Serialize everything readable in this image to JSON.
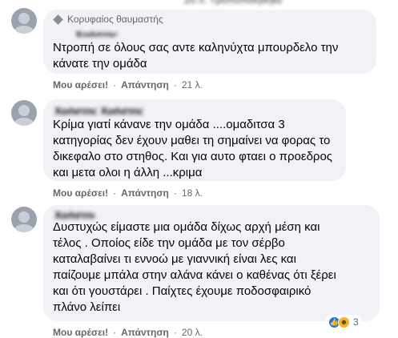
{
  "comments": [
    {
      "badge": "Κορυφαίος θαυμαστής",
      "author": "",
      "text": "Ντροπή σε όλους σας αντε καληνύχτα μπουρδελο την\nκάνατε την ομάδα",
      "like": "Μου αρέσει!",
      "reply": "Απάντηση",
      "time": "21 λ."
    },
    {
      "author": "",
      "text": "Κρίμα γιατί κάνανε την ομάδα ....ομαδιτσα 3\nκατηγορίας δεν έχουν μαθει τη σημαίνει να φορας το\nδικεφαλο στο στηθος. Και για αυτο φταει ο προεδρος\nκαι μετα ολοι η άλλη ...κριμα",
      "like": "Μου αρέσει!",
      "reply": "Απάντηση",
      "time": "18 λ."
    },
    {
      "author": "",
      "text": "Δυστυχώς είμαστε μια ομάδα δίχως αρχή μέση και\nτέλος . Οποίος είδε την ομάδα με τον σέρβο\nκαταλαβαίνει τι εννοώ με γιαννική είναι λες και\nπαίζουμε μπάλα στην αλάνα κάνει ο καθένας ότι ξέρει\nκαι ότι γουστάρει . Παίχτες έχουμε ποδοσφαιρικό\nπλάνο λείπει",
      "like": "Μου αρέσει!",
      "reply": "Απάντηση",
      "time": "20 λ.",
      "reactions": {
        "count": "3"
      }
    }
  ],
  "icons": {
    "badge": "diamond-icon",
    "like_reaction": "like-reaction-icon",
    "haha_reaction": "haha-reaction-icon"
  },
  "colors": {
    "bubble": "#f0f2f5",
    "meta_text": "#65676b",
    "like_blue": "#1877f2",
    "haha_yellow": "#f7b125"
  }
}
